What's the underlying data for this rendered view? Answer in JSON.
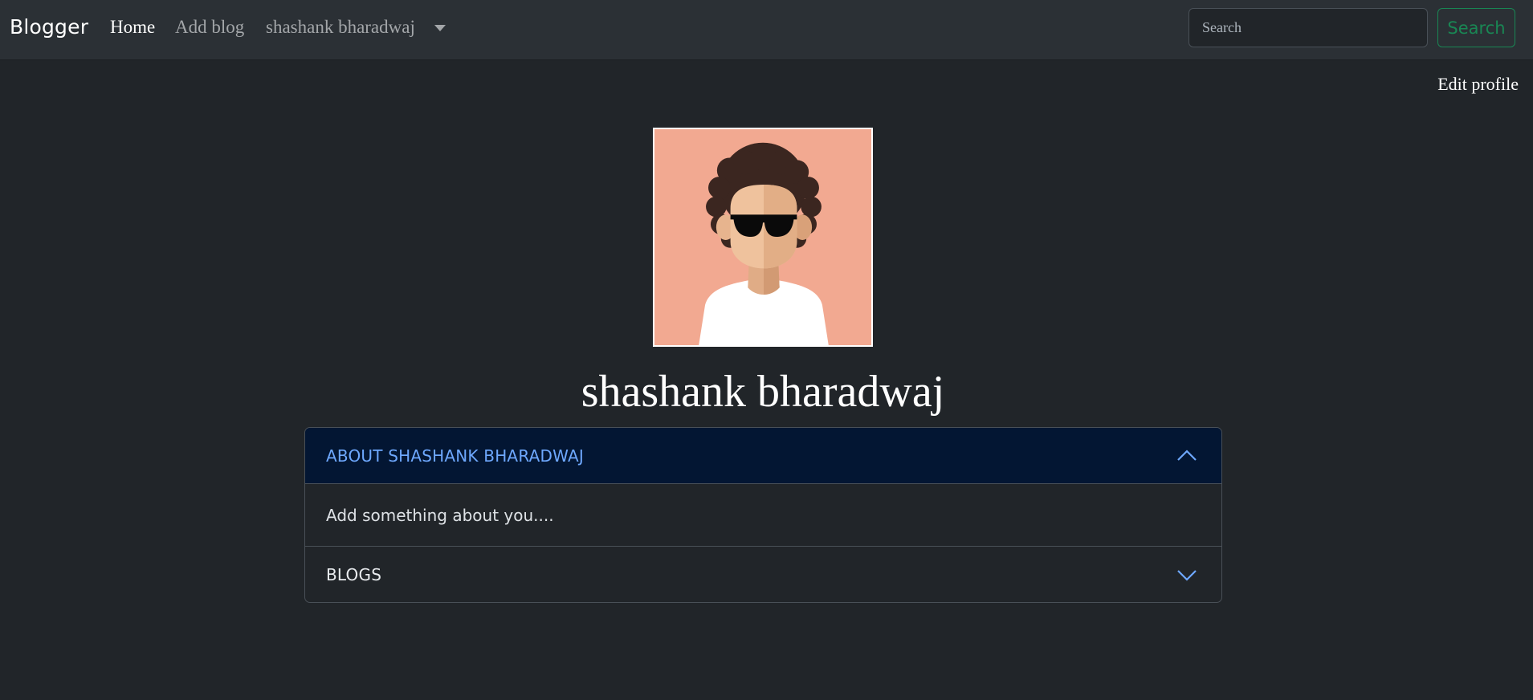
{
  "navbar": {
    "brand": "Blogger",
    "links": {
      "home": "Home",
      "add_blog": "Add blog",
      "user": "shashank bharadwaj"
    },
    "search": {
      "placeholder": "Search",
      "button_label": "Search"
    }
  },
  "page": {
    "edit_profile_label": "Edit profile",
    "profile_name": "shashank bharadwaj",
    "avatar_icon": "avatar-illustration"
  },
  "accordion": {
    "about": {
      "title": "ABOUT SHASHANK BHARADWAJ",
      "body": "Add something about you....",
      "expanded": true
    },
    "blogs": {
      "title": "BLOGS",
      "expanded": false
    }
  },
  "colors": {
    "background": "#212529",
    "navbar": "#2b3035",
    "accent_blue": "#6ea8fe",
    "accordion_active_bg": "#031633",
    "success_green": "#198754",
    "avatar_bg": "#f2a991"
  }
}
